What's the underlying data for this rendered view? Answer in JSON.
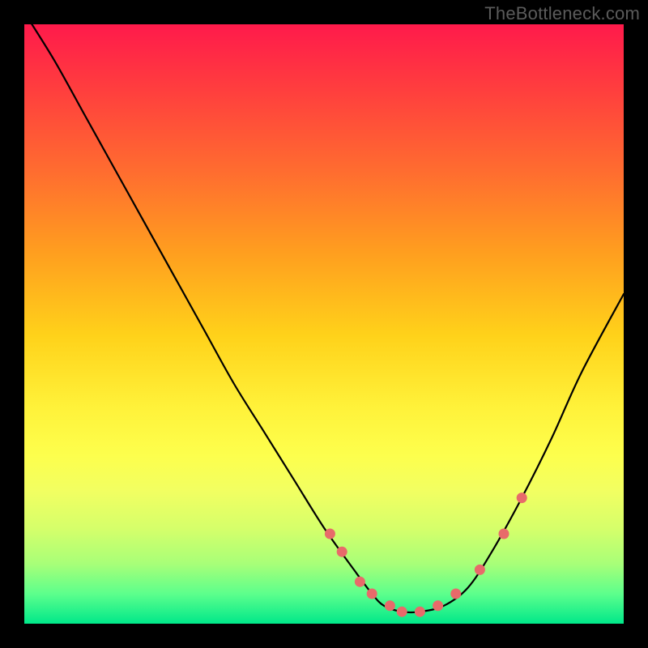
{
  "watermark": "TheBottleneck.com",
  "chart_data": {
    "type": "line",
    "title": "",
    "xlabel": "",
    "ylabel": "",
    "xlim": [
      0,
      1
    ],
    "ylim": [
      0,
      1
    ],
    "series": [
      {
        "name": "curve",
        "x": [
          0.0,
          0.05,
          0.1,
          0.15,
          0.2,
          0.25,
          0.3,
          0.35,
          0.4,
          0.45,
          0.5,
          0.55,
          0.58,
          0.6,
          0.63,
          0.66,
          0.7,
          0.74,
          0.78,
          0.83,
          0.88,
          0.93,
          1.0
        ],
        "values": [
          1.02,
          0.94,
          0.85,
          0.76,
          0.67,
          0.58,
          0.49,
          0.4,
          0.32,
          0.24,
          0.16,
          0.09,
          0.05,
          0.03,
          0.02,
          0.02,
          0.03,
          0.06,
          0.12,
          0.21,
          0.31,
          0.42,
          0.55
        ]
      }
    ],
    "markers": {
      "name": "dots",
      "color": "#e86a6a",
      "x": [
        0.51,
        0.53,
        0.56,
        0.58,
        0.61,
        0.63,
        0.66,
        0.69,
        0.72,
        0.76,
        0.8,
        0.83
      ],
      "values": [
        0.15,
        0.12,
        0.07,
        0.05,
        0.03,
        0.02,
        0.02,
        0.03,
        0.05,
        0.09,
        0.15,
        0.21
      ]
    }
  }
}
